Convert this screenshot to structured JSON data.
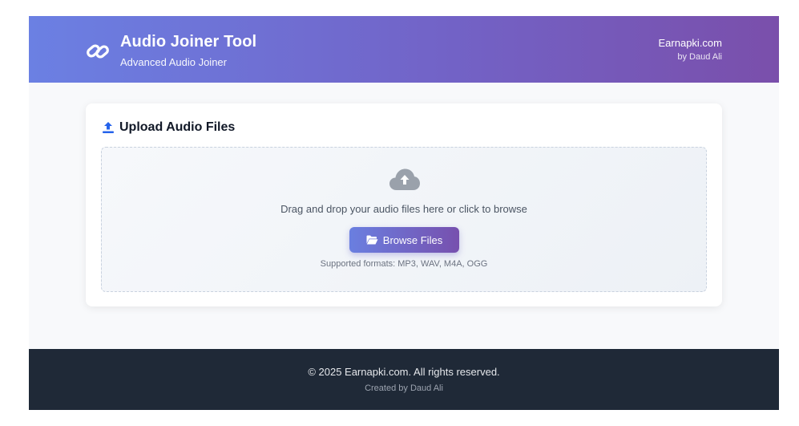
{
  "header": {
    "title": "Audio Joiner Tool",
    "subtitle": "Advanced Audio Joiner",
    "site": "Earnapki.com",
    "author": "by Daud Ali",
    "logo_icon": "link-icon"
  },
  "upload": {
    "title": "Upload Audio Files",
    "title_icon": "upload-icon",
    "drop_icon": "cloud-upload-icon",
    "drop_text": "Drag and drop your audio files here or click to browse",
    "browse_label": "Browse Files",
    "browse_icon": "folder-open-icon",
    "formats": "Supported formats: MP3, WAV, M4A, OGG"
  },
  "footer": {
    "copyright": "© 2025 Earnapki.com. All rights reserved.",
    "created": "Created by Daud Ali"
  },
  "colors": {
    "header_start": "#6b80e3",
    "header_end": "#7a4fab",
    "accent_blue": "#2563eb",
    "footer_bg": "#1f2937"
  }
}
